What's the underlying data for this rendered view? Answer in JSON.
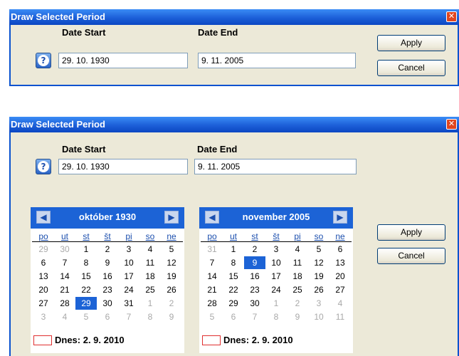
{
  "dialog_collapsed": {
    "title": "Draw Selected Period",
    "date_start_label": "Date Start",
    "date_start_value": "29. 10. 1930",
    "date_end_label": "Date End",
    "date_end_value": "9. 11. 2005",
    "apply_label": "Apply",
    "cancel_label": "Cancel"
  },
  "dialog_expanded": {
    "title": "Draw Selected Period",
    "date_start_label": "Date Start",
    "date_start_value": "29. 10. 1930",
    "date_end_label": "Date End",
    "date_end_value": "9. 11. 2005",
    "apply_label": "Apply",
    "cancel_label": "Cancel"
  },
  "calendars": [
    {
      "month_label": "október 1930",
      "today_label": "Dnes: 2. 9. 2010",
      "weekdays": [
        "po",
        "ut",
        "st",
        "št",
        "pi",
        "so",
        "ne"
      ],
      "days": [
        [
          "29",
          "30",
          "1",
          "2",
          "3",
          "4",
          "5"
        ],
        [
          "6",
          "7",
          "8",
          "9",
          "10",
          "11",
          "12"
        ],
        [
          "13",
          "14",
          "15",
          "16",
          "17",
          "18",
          "19"
        ],
        [
          "20",
          "21",
          "22",
          "23",
          "24",
          "25",
          "26"
        ],
        [
          "27",
          "28",
          "29",
          "30",
          "31",
          "1",
          "2"
        ],
        [
          "3",
          "4",
          "5",
          "6",
          "7",
          "8",
          "9"
        ]
      ],
      "other_month": [
        [
          1,
          1,
          0,
          0,
          0,
          0,
          0
        ],
        [
          0,
          0,
          0,
          0,
          0,
          0,
          0
        ],
        [
          0,
          0,
          0,
          0,
          0,
          0,
          0
        ],
        [
          0,
          0,
          0,
          0,
          0,
          0,
          0
        ],
        [
          0,
          0,
          0,
          0,
          0,
          1,
          1
        ],
        [
          1,
          1,
          1,
          1,
          1,
          1,
          1
        ]
      ],
      "selected": [
        4,
        2
      ]
    },
    {
      "month_label": "november 2005",
      "today_label": "Dnes: 2. 9. 2010",
      "weekdays": [
        "po",
        "ut",
        "st",
        "št",
        "pi",
        "so",
        "ne"
      ],
      "days": [
        [
          "31",
          "1",
          "2",
          "3",
          "4",
          "5",
          "6"
        ],
        [
          "7",
          "8",
          "9",
          "10",
          "11",
          "12",
          "13"
        ],
        [
          "14",
          "15",
          "16",
          "17",
          "18",
          "19",
          "20"
        ],
        [
          "21",
          "22",
          "23",
          "24",
          "25",
          "26",
          "27"
        ],
        [
          "28",
          "29",
          "30",
          "1",
          "2",
          "3",
          "4"
        ],
        [
          "5",
          "6",
          "7",
          "8",
          "9",
          "10",
          "11"
        ]
      ],
      "other_month": [
        [
          1,
          0,
          0,
          0,
          0,
          0,
          0
        ],
        [
          0,
          0,
          0,
          0,
          0,
          0,
          0
        ],
        [
          0,
          0,
          0,
          0,
          0,
          0,
          0
        ],
        [
          0,
          0,
          0,
          0,
          0,
          0,
          0
        ],
        [
          0,
          0,
          0,
          1,
          1,
          1,
          1
        ],
        [
          1,
          1,
          1,
          1,
          1,
          1,
          1
        ]
      ],
      "selected": [
        1,
        2
      ]
    }
  ],
  "icons": {
    "help": "help-icon",
    "close": "close-icon",
    "prev": "chevron-left-icon",
    "next": "chevron-right-icon"
  },
  "colors": {
    "title_bar": "#1c5fd8",
    "dialog_bg": "#ece9d8",
    "calendar_header": "#1c63d6",
    "selected_day": "#1c63d6",
    "today_marker": "#e03030"
  }
}
